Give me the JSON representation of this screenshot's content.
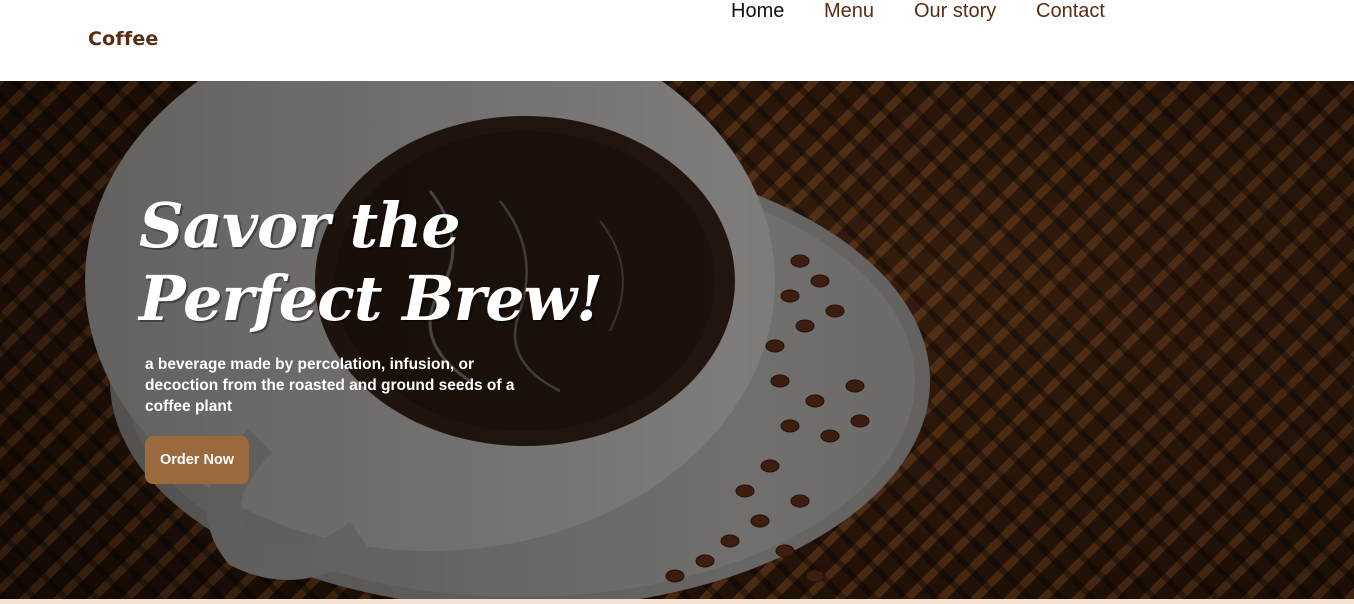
{
  "navbar": {
    "brand": "Coffee",
    "links": [
      {
        "label": "Home",
        "active": true
      },
      {
        "label": "Menu",
        "active": false
      },
      {
        "label": "Our story",
        "active": false
      },
      {
        "label": "Contact",
        "active": false
      }
    ]
  },
  "hero": {
    "title_line1": "Savor the",
    "title_line2": "Perfect Brew!",
    "description": "a beverage made by percolation, infusion, or decoction from the roasted and ground seeds of a coffee plant",
    "cta_label": "Order Now",
    "image_subject": "cup of black coffee on a saucer with coffee beans on a woven mat"
  },
  "colors": {
    "brand_text": "#5a2c12",
    "active_link": "#111111",
    "button_bg": "#9a6a3e",
    "hero_text": "#ffffff",
    "bottom_strip": "#f6e3cf"
  }
}
